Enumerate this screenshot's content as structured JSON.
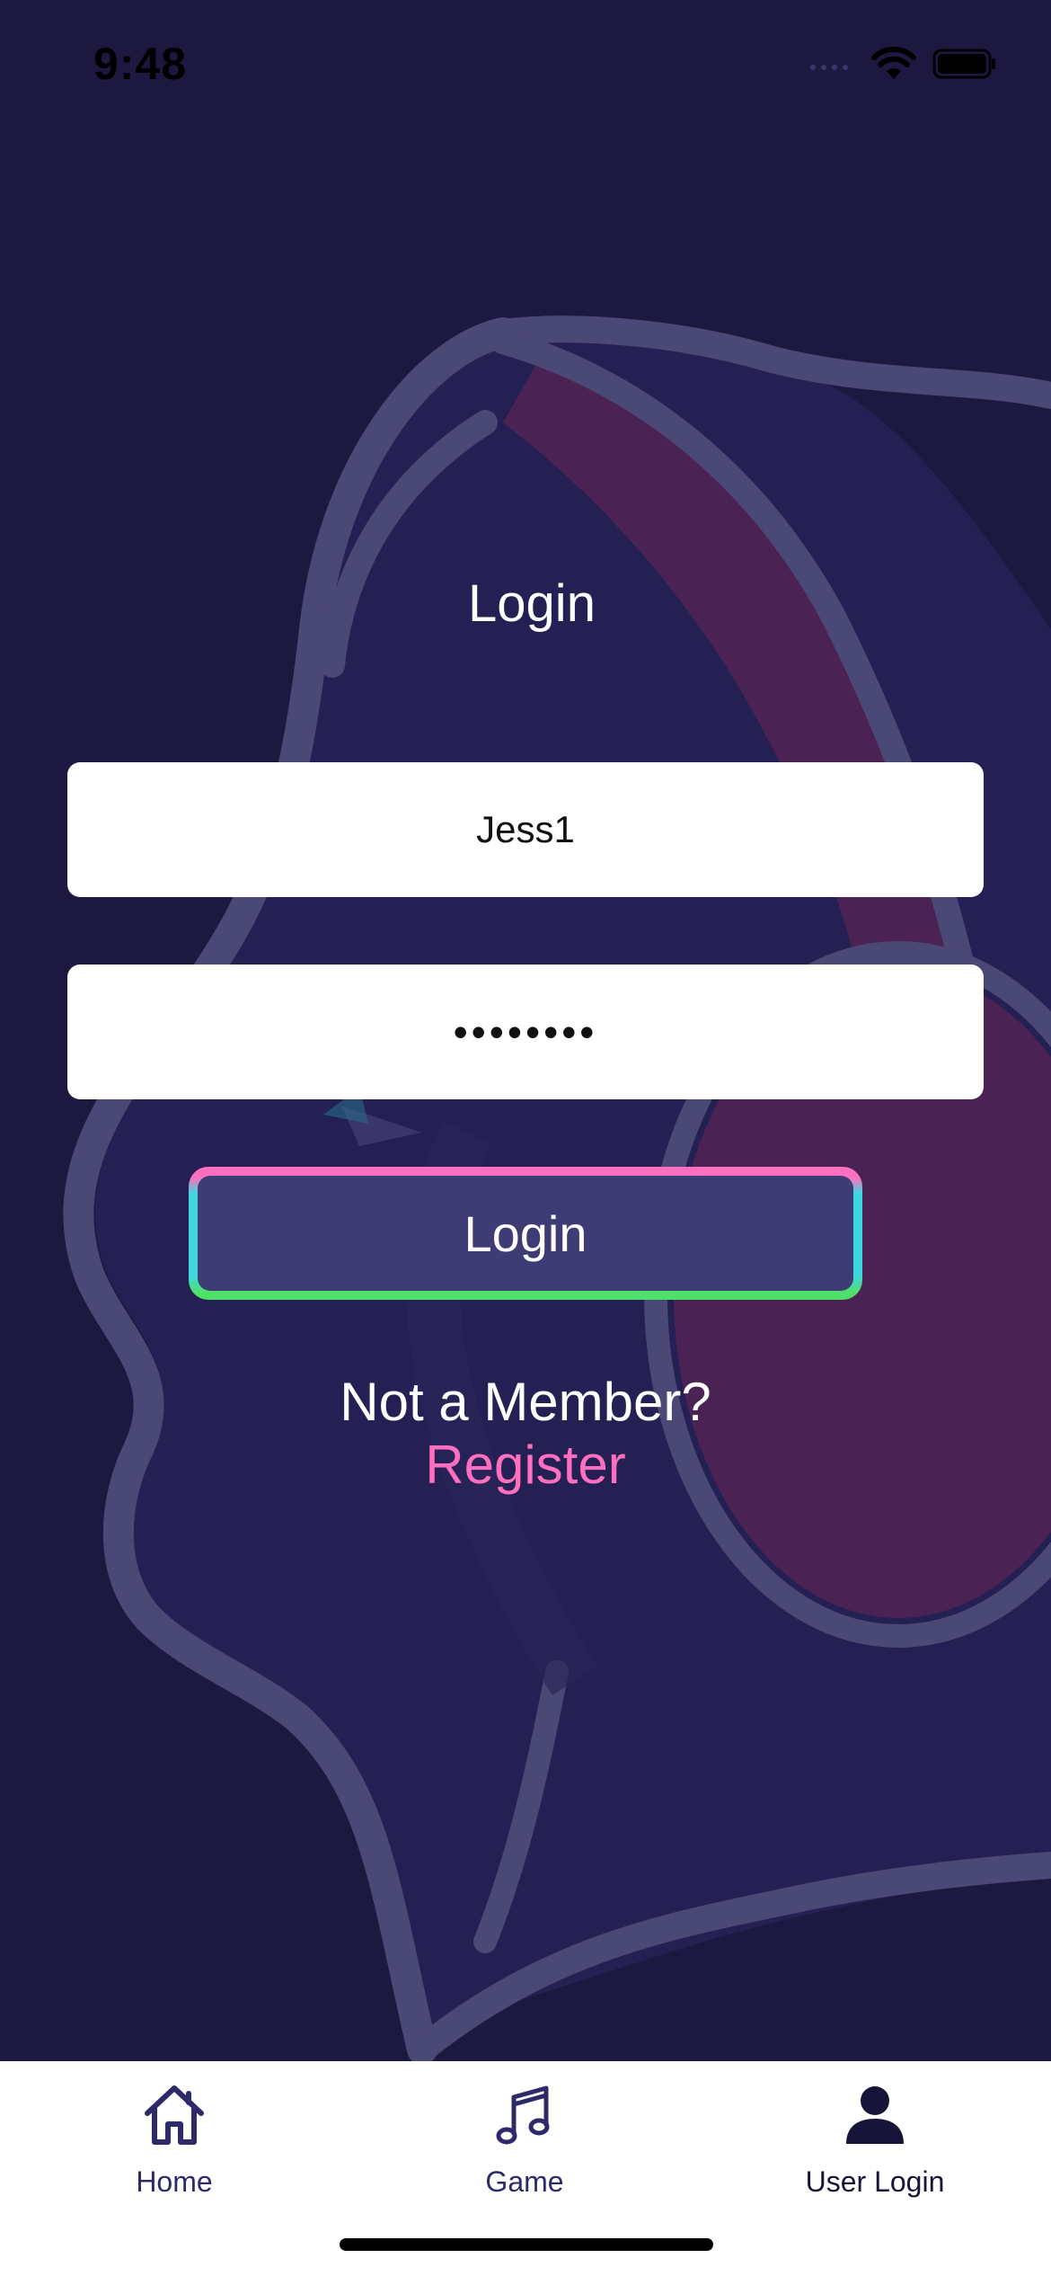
{
  "status_bar": {
    "time": "9:48"
  },
  "login": {
    "title": "Login",
    "username_value": "Jess1",
    "password_value": "••••••••",
    "submit_label": "Login",
    "member_prompt": "Not a Member?",
    "register_label": "Register"
  },
  "tab_bar": {
    "items": [
      {
        "label": "Home",
        "icon": "home-icon"
      },
      {
        "label": "Game",
        "icon": "music-note-icon"
      },
      {
        "label": "User Login",
        "icon": "user-icon",
        "active": true
      }
    ]
  },
  "colors": {
    "background": "#1c1840",
    "button_fill": "#3d3c75",
    "register_link": "#ff6fbf",
    "button_border_top": "#ff6fbf",
    "button_border_sides": "#3fd6e0",
    "button_border_bottom": "#4fe06a",
    "art_outline": "#4a4874",
    "art_headphone": "#4a2354"
  }
}
